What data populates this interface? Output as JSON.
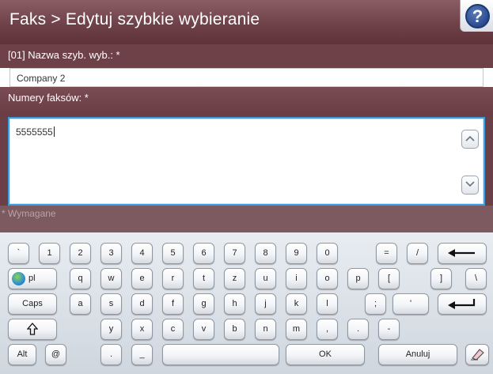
{
  "header": {
    "title": "Faks > Edytuj szybkie wybieranie",
    "help_symbol": "?",
    "help_icon": "help-icon",
    "colors": {
      "header": "#6f4148",
      "accent_focus": "#3aa0e6"
    }
  },
  "form": {
    "name_label": "[01] Nazwa szyb. wyb.: *",
    "name_value": "Company 2",
    "fax_label": "Numery faksów: *",
    "fax_value": "5555555",
    "required_note": "* Wymagane",
    "scroll_up_icon": "chevron-up-icon",
    "scroll_down_icon": "chevron-down-icon"
  },
  "keyboard": {
    "row1": [
      "`",
      "1",
      "2",
      "3",
      "4",
      "5",
      "6",
      "7",
      "8",
      "9",
      "0",
      "=",
      "/"
    ],
    "backspace_icon": "backspace-arrow-icon",
    "language": "pl",
    "row2": [
      "q",
      "w",
      "e",
      "r",
      "t",
      "z",
      "u",
      "i",
      "o",
      "p",
      "[",
      "]",
      "\\"
    ],
    "caps": "Caps",
    "row3": [
      "a",
      "s",
      "d",
      "f",
      "g",
      "h",
      "j",
      "k",
      "l",
      ";",
      "'"
    ],
    "enter_icon": "enter-icon",
    "shift_icon": "shift-arrow-icon",
    "row4": [
      "y",
      "x",
      "c",
      "v",
      "b",
      "n",
      "m",
      ",",
      ".",
      "-"
    ],
    "alt": "Alt",
    "at": "@",
    "dot": ".",
    "underscore": "_",
    "ok": "OK",
    "cancel": "Anuluj",
    "eraser_icon": "eraser-icon"
  }
}
